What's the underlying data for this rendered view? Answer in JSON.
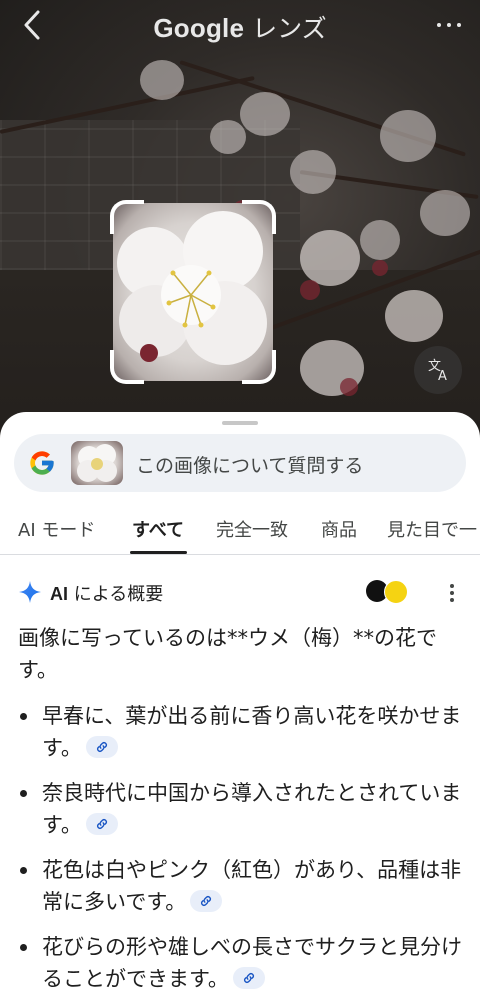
{
  "topbar": {
    "title_brand": "Google",
    "title_suffix": "レンズ",
    "back_icon": "chevron-left-icon",
    "more_icon": "more-horizontal-icon"
  },
  "photo": {
    "translate_icon": "translate-icon"
  },
  "search": {
    "placeholder": "この画像について質問する"
  },
  "tabs": [
    {
      "label": "AI モード"
    },
    {
      "label": "すべて",
      "active": true
    },
    {
      "label": "完全一致"
    },
    {
      "label": "商品"
    },
    {
      "label": "見た目で一"
    }
  ],
  "ai_overview": {
    "title_prefix": "AI",
    "title_suffix": "による概要",
    "intro": "画像に写っているのは**ウメ（梅）**の花です。",
    "bullets": [
      {
        "text": "早春に、葉が出る前に香り高い花を咲かせます。"
      },
      {
        "text": "奈良時代に中国から導入されたとされています。"
      },
      {
        "text": "花色は白やピンク（紅色）があり、品種は非常に多いです。"
      },
      {
        "text": "花びらの形や雄しべの長さでサクラと見分けることができます。"
      }
    ]
  },
  "colors": {
    "accent_blue": "#4285f4",
    "text": "#1f1f1f",
    "search_bg": "#eef1f5"
  }
}
